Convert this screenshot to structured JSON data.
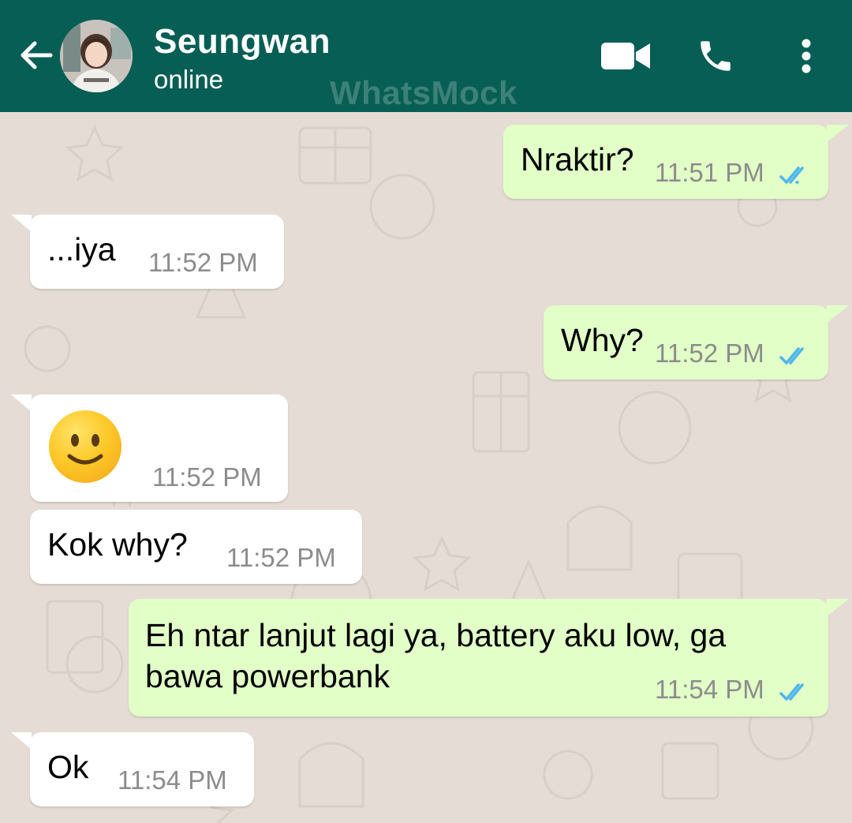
{
  "header": {
    "contact_name": "Seungwan",
    "status": "online",
    "watermark": "WhatsMock",
    "icons": [
      "back-arrow-icon",
      "video-call-icon",
      "phone-icon",
      "more-options-icon"
    ]
  },
  "colors": {
    "header_bg": "#075e54",
    "chat_bg": "#e5ddd5",
    "outgoing_bubble": "#e2ffc7",
    "incoming_bubble": "#ffffff",
    "read_ticks": "#4fb6ec",
    "timestamp": "#8c8c8c"
  },
  "messages": [
    {
      "direction": "outgoing",
      "text": "Nraktir?",
      "time": "11:51 PM",
      "status": "read"
    },
    {
      "direction": "incoming",
      "text": "...iya",
      "time": "11:52 PM"
    },
    {
      "direction": "outgoing",
      "text": "Why?",
      "time": "11:52 PM",
      "status": "read"
    },
    {
      "direction": "incoming",
      "emoji": "slightly-smiling-face",
      "time": "11:52 PM"
    },
    {
      "direction": "incoming",
      "text": "Kok why?",
      "time": "11:52 PM"
    },
    {
      "direction": "outgoing",
      "text": "Eh ntar lanjut lagi ya, battery aku low, ga\nbawa powerbank",
      "time": "11:54 PM",
      "status": "read"
    },
    {
      "direction": "incoming",
      "text": "Ok",
      "time": "11:54 PM"
    }
  ]
}
